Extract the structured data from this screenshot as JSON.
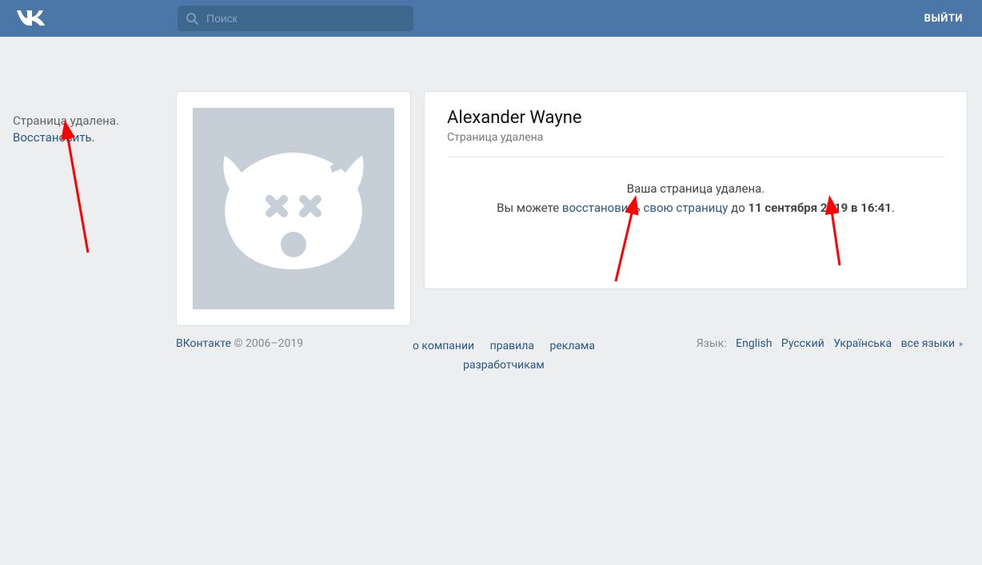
{
  "header": {
    "search_placeholder": "Поиск",
    "logout_label": "ВЫЙТИ"
  },
  "sidebar": {
    "deleted_text": "Страница удалена.",
    "restore_link": "Восстановить."
  },
  "profile": {
    "name": "Alexander Wayne",
    "subtitle": "Страница удалена",
    "deleted_heading": "Ваша страница удалена.",
    "restore_prefix": "Вы можете ",
    "restore_link_text": "восстановить свою страницу",
    "restore_mid": " до ",
    "restore_deadline": "11 сентября 2019 в 16:41",
    "restore_suffix": "."
  },
  "footer": {
    "brand": "ВКонтакте",
    "copyright": " © 2006–2019",
    "links": {
      "about": "о компании",
      "rules": "правила",
      "ads": "реклама",
      "devs": "разработчикам"
    },
    "lang_label": "Язык:",
    "langs": {
      "en": "English",
      "ru": "Русский",
      "ua": "Українська",
      "all": "все языки"
    }
  }
}
